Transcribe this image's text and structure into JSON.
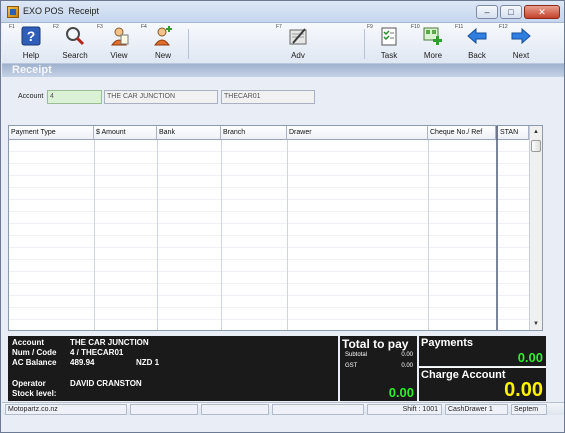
{
  "window": {
    "app_name": "EXO POS",
    "title": "Receipt",
    "controls": [
      "–",
      "□",
      "✕"
    ]
  },
  "toolbar": {
    "buttons": [
      {
        "key": "F1",
        "label": "Help",
        "icon": "help-icon"
      },
      {
        "key": "F2",
        "label": "Search",
        "icon": "search-icon"
      },
      {
        "key": "F3",
        "label": "View",
        "icon": "view-icon"
      },
      {
        "key": "F4",
        "label": "New",
        "icon": "new-icon"
      },
      {
        "key": "F7",
        "label": "Adv",
        "icon": "advanced-icon"
      },
      {
        "key": "F9",
        "label": "Task",
        "icon": "task-icon"
      },
      {
        "key": "F10",
        "label": "More",
        "icon": "more-icon"
      },
      {
        "key": "F11",
        "label": "Back",
        "icon": "back-arrow-icon"
      },
      {
        "key": "F12",
        "label": "Next",
        "icon": "next-arrow-icon"
      }
    ]
  },
  "section": {
    "title": "Receipt"
  },
  "account": {
    "label": "Account",
    "number": "4",
    "name": "THE CAR JUNCTION",
    "code": "THECAR01"
  },
  "grid": {
    "columns": [
      "Payment Type",
      "$ Amount",
      "Bank",
      "Branch",
      "Drawer",
      "Cheque No./ Ref",
      "STAN"
    ],
    "rows": []
  },
  "info": {
    "account_label": "Account",
    "account_value": "THE CAR JUNCTION",
    "numcode_label": "Num / Code",
    "numcode_value": "4 / THECAR01",
    "balance_label": "AC Balance",
    "balance_value": "489.94",
    "balance_currency": "NZD 1",
    "operator_label": "Operator",
    "operator_value": "DAVID CRANSTON",
    "stock_label": "Stock level:"
  },
  "totals": {
    "title": "Total to pay",
    "subtotal_label": "Subtotal",
    "subtotal_value": "0.00",
    "gst_label": "GST",
    "gst_value": "0.00",
    "total_value": "0.00"
  },
  "payments": {
    "title": "Payments",
    "value": "0.00"
  },
  "charge": {
    "title": "Charge Account",
    "value": "0.00"
  },
  "status": {
    "site": "Motopartz.co.nz",
    "shift": "Shift : 1001",
    "drawer": "CashDrawer 1",
    "date": "Septem"
  },
  "colors": {
    "panel_bg": "#1a1a1a",
    "green_amount": "#2bf02b",
    "yellow_amount": "#fff200",
    "header_band": "#9fb1cd"
  }
}
